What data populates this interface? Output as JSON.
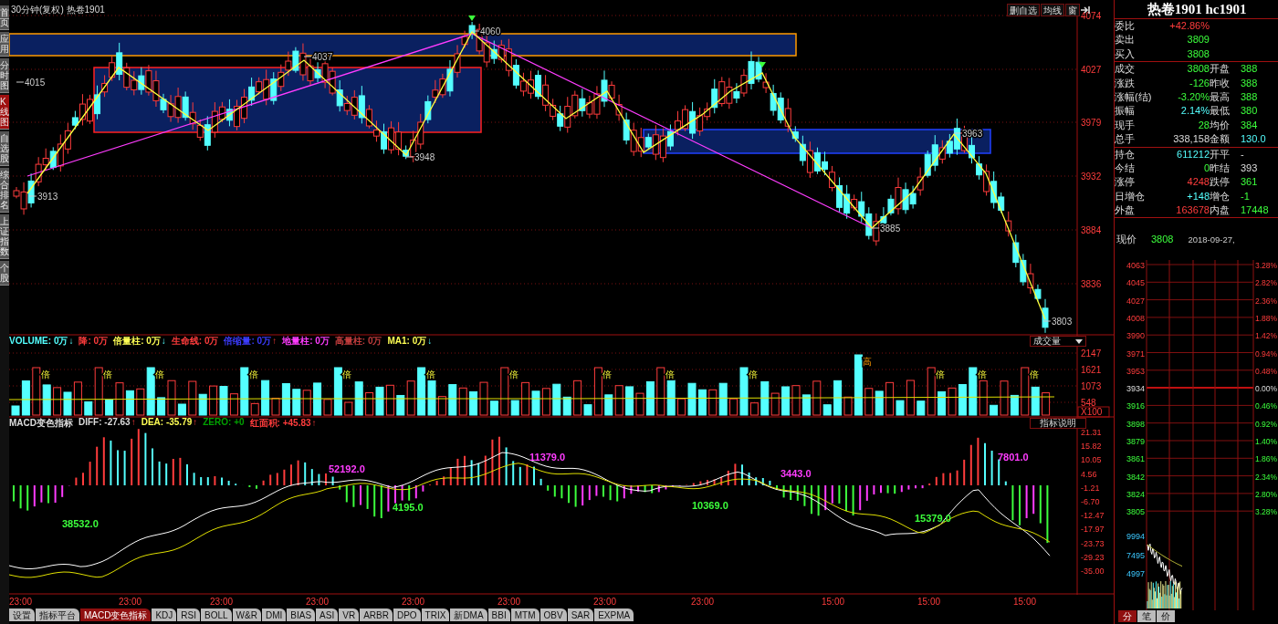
{
  "header": {
    "title": "30分钟(复权)  热卷1901",
    "buttons": [
      "删自选",
      "均线",
      "窗"
    ]
  },
  "side_tabs": [
    {
      "label": "首页",
      "selected": false
    },
    {
      "label": "应用",
      "selected": false
    },
    {
      "label": "分时图",
      "selected": false
    },
    {
      "label": "K线图",
      "selected": true
    },
    {
      "label": "自选股",
      "selected": false
    },
    {
      "label": "综合排名",
      "selected": false
    },
    {
      "label": "上证指数",
      "selected": false
    },
    {
      "label": "个股",
      "selected": false
    }
  ],
  "price_chart": {
    "axis": [
      "4074",
      "4027",
      "3979",
      "3932",
      "3884",
      "3836"
    ],
    "annotations": [
      "4015",
      "3913",
      "4037",
      "3948",
      "4060",
      "3885",
      "3963",
      "3803"
    ]
  },
  "volume": {
    "legend": [
      {
        "text": "VOLUME: 0万",
        "arrow": "↓",
        "color": "#54ffff"
      },
      {
        "text": "降: 0万",
        "color": "#ff3c3c"
      },
      {
        "text": "倍量柱: 0万",
        "arrow": "↓",
        "color": "#ffff54"
      },
      {
        "text": "生命线: 0万",
        "color": "#ff3c3c"
      },
      {
        "text": "倍缩量: 0万",
        "arrow": "↑",
        "color": "#3c3cff"
      },
      {
        "text": "地量柱: 0万",
        "color": "#ff3cff"
      },
      {
        "text": "高量柱: 0万",
        "color": "#c03c3c"
      },
      {
        "text": "MA1: 0万",
        "arrow": "↓",
        "color": "#ffff54"
      }
    ],
    "selector": "成交量",
    "axis": [
      "2147",
      "1621",
      "1073",
      "548"
    ],
    "unit": "X100",
    "marks": [
      {
        "text": "倍",
        "kind": "double"
      },
      {
        "text": "倍",
        "kind": "double"
      },
      {
        "text": "倍",
        "kind": "double"
      },
      {
        "text": "倍",
        "kind": "double"
      },
      {
        "text": "倍",
        "kind": "double"
      },
      {
        "text": "倍",
        "kind": "double"
      },
      {
        "text": "倍",
        "kind": "double"
      },
      {
        "text": "倍",
        "kind": "double"
      },
      {
        "text": "倍",
        "kind": "double"
      },
      {
        "text": "倍",
        "kind": "double"
      },
      {
        "text": "高",
        "kind": "high"
      },
      {
        "text": "倍",
        "kind": "double"
      },
      {
        "text": "倍",
        "kind": "double"
      },
      {
        "text": "倍",
        "kind": "double"
      }
    ]
  },
  "macd": {
    "legend": [
      {
        "text": "MACD变色指标",
        "color": "#dddddd"
      },
      {
        "text": "DIFF: -27.63",
        "arrow": "↑",
        "color": "#dddddd"
      },
      {
        "text": "DEA: -35.79",
        "arrow": "↑",
        "color": "#ffff54"
      },
      {
        "text": "ZERO: +0",
        "color": "#00a000"
      },
      {
        "text": "红面积: +45.83",
        "arrow": "↑",
        "color": "#ff3c3c"
      }
    ],
    "help_button": "指标说明",
    "axis": [
      "21.31",
      "15.82",
      "10.05",
      "4.56",
      "-1.21",
      "-6.70",
      "-12.47",
      "-17.97",
      "-23.73",
      "-29.23",
      "-35.00"
    ],
    "annotations": [
      {
        "text": "38532.0",
        "color": "#3cff3c"
      },
      {
        "text": "52192.0",
        "color": "#ff3cff"
      },
      {
        "text": "4195.0",
        "color": "#3cff3c"
      },
      {
        "text": "11379.0",
        "color": "#ff3cff"
      },
      {
        "text": "10369.0",
        "color": "#3cff3c"
      },
      {
        "text": "3443.0",
        "color": "#ff3cff"
      },
      {
        "text": "15379.0",
        "color": "#3cff3c"
      },
      {
        "text": "7801.0",
        "color": "#ff3cff"
      }
    ]
  },
  "time_axis": [
    "23:00",
    "23:00",
    "23:00",
    "23:00",
    "23:00",
    "23:00",
    "23:00",
    "23:00",
    "15:00",
    "15:00",
    "15:00"
  ],
  "indicator_tabs": [
    {
      "label": "设置",
      "selected": false
    },
    {
      "label": "指标平台",
      "selected": false
    },
    {
      "label": "MACD变色指标",
      "selected": true
    },
    {
      "label": "KDJ",
      "selected": false
    },
    {
      "label": "RSI",
      "selected": false
    },
    {
      "label": "BOLL",
      "selected": false
    },
    {
      "label": "W&R",
      "selected": false
    },
    {
      "label": "DMI",
      "selected": false
    },
    {
      "label": "BIAS",
      "selected": false
    },
    {
      "label": "ASI",
      "selected": false
    },
    {
      "label": "VR",
      "selected": false
    },
    {
      "label": "ARBR",
      "selected": false
    },
    {
      "label": "DPO",
      "selected": false
    },
    {
      "label": "TRIX",
      "selected": false
    },
    {
      "label": "新DMA",
      "selected": false
    },
    {
      "label": "BBI",
      "selected": false
    },
    {
      "label": "MTM",
      "selected": false
    },
    {
      "label": "OBV",
      "selected": false
    },
    {
      "label": "SAR",
      "selected": false
    },
    {
      "label": "EXPMA",
      "selected": false
    }
  ],
  "quote": {
    "title": "热卷1901 hc1901",
    "sections": [
      [
        [
          {
            "label": "委比",
            "value": "+42.86%",
            "kind": "up"
          }
        ],
        [
          {
            "label": "卖出",
            "value": "3809",
            "kind": "down"
          }
        ],
        [
          {
            "label": "买入",
            "value": "3808",
            "kind": "down"
          }
        ]
      ],
      [
        [
          {
            "label": "成交",
            "value": "3808",
            "kind": "down"
          },
          {
            "label": "开盘",
            "value": "388",
            "kind": "down"
          }
        ],
        [
          {
            "label": "涨跌",
            "value": "-126",
            "kind": "down"
          },
          {
            "label": "昨收",
            "value": "388",
            "kind": "down"
          }
        ],
        [
          {
            "label": "涨幅(结)",
            "value": "-3.20%",
            "kind": "down"
          },
          {
            "label": "最高",
            "value": "388",
            "kind": "down"
          }
        ],
        [
          {
            "label": "振幅",
            "value": "2.14%",
            "kind": "info"
          },
          {
            "label": "最低",
            "value": "380",
            "kind": "down"
          }
        ],
        [
          {
            "label": "现手",
            "value": "28",
            "kind": "down"
          },
          {
            "label": "均价",
            "value": "384",
            "kind": "down"
          }
        ],
        [
          {
            "label": "总手",
            "value": "338,158",
            "kind": "flat"
          },
          {
            "label": "金额",
            "value": "130.0",
            "kind": "info"
          }
        ]
      ],
      [
        [
          {
            "label": "持仓",
            "value": "611212",
            "kind": "info"
          },
          {
            "label": "开平",
            "value": "-",
            "kind": "flat"
          }
        ],
        [
          {
            "label": "今结",
            "value": "0",
            "kind": "down"
          },
          {
            "label": "昨结",
            "value": "393",
            "kind": "flat"
          }
        ],
        [
          {
            "label": "涨停",
            "value": "4248",
            "kind": "up"
          },
          {
            "label": "跌停",
            "value": "361",
            "kind": "down"
          }
        ],
        [
          {
            "label": "日增仓",
            "value": "+148",
            "kind": "info"
          },
          {
            "label": "增仓",
            "value": "-1",
            "kind": "down"
          }
        ],
        [
          {
            "label": "外盘",
            "value": "163678",
            "kind": "up"
          },
          {
            "label": "内盘",
            "value": "17448",
            "kind": "down"
          }
        ]
      ]
    ],
    "price": {
      "label": "现价",
      "value": "3808",
      "date": "2018-09-27,"
    }
  },
  "minute_chart": {
    "price_axis": [
      {
        "text": "4063",
        "kind": "up"
      },
      {
        "text": "4045",
        "kind": "up"
      },
      {
        "text": "4027",
        "kind": "up"
      },
      {
        "text": "4008",
        "kind": "up"
      },
      {
        "text": "3990",
        "kind": "up"
      },
      {
        "text": "3971",
        "kind": "up"
      },
      {
        "text": "3953",
        "kind": "up"
      },
      {
        "text": "3934",
        "kind": "flat"
      },
      {
        "text": "3916",
        "kind": "down"
      },
      {
        "text": "3898",
        "kind": "down"
      },
      {
        "text": "3879",
        "kind": "down"
      },
      {
        "text": "3861",
        "kind": "down"
      },
      {
        "text": "3842",
        "kind": "down"
      },
      {
        "text": "3824",
        "kind": "down"
      },
      {
        "text": "3805",
        "kind": "down"
      }
    ],
    "percent_axis": [
      {
        "text": "3.28%",
        "kind": "up"
      },
      {
        "text": "2.82%",
        "kind": "up"
      },
      {
        "text": "2.36%",
        "kind": "up"
      },
      {
        "text": "1.88%",
        "kind": "up"
      },
      {
        "text": "1.42%",
        "kind": "up"
      },
      {
        "text": "0.94%",
        "kind": "up"
      },
      {
        "text": "0.48%",
        "kind": "up"
      },
      {
        "text": "0.00%",
        "kind": "flat"
      },
      {
        "text": "0.46%",
        "kind": "down"
      },
      {
        "text": "0.92%",
        "kind": "down"
      },
      {
        "text": "1.40%",
        "kind": "down"
      },
      {
        "text": "1.86%",
        "kind": "down"
      },
      {
        "text": "2.34%",
        "kind": "down"
      },
      {
        "text": "2.80%",
        "kind": "down"
      },
      {
        "text": "3.28%",
        "kind": "down"
      }
    ],
    "volume_axis": [
      "9994",
      "7495",
      "4997"
    ],
    "tabs": [
      {
        "label": "分",
        "selected": true
      },
      {
        "label": "笔",
        "selected": false
      },
      {
        "label": "价",
        "selected": false
      }
    ]
  }
}
